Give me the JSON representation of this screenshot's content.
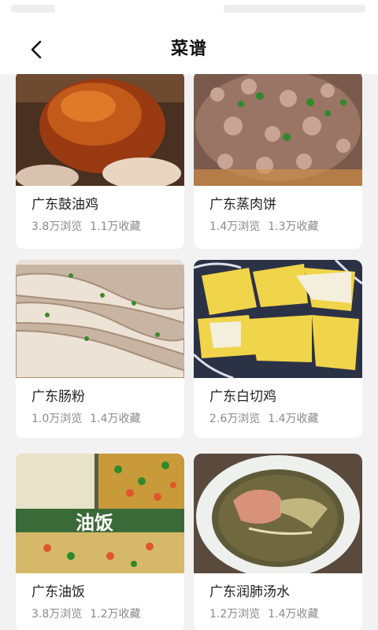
{
  "header": {
    "title": "菜谱"
  },
  "recipes": [
    {
      "name": "广东鼓油鸡",
      "views": "3.8万浏览",
      "favorites": "1.1万收藏"
    },
    {
      "name": "广东蒸肉饼",
      "views": "1.4万浏览",
      "favorites": "1.3万收藏"
    },
    {
      "name": "广东肠粉",
      "views": "1.0万浏览",
      "favorites": "1.4万收藏"
    },
    {
      "name": "广东白切鸡",
      "views": "2.6万浏览",
      "favorites": "1.4万收藏"
    },
    {
      "name": "广东油饭",
      "views": "3.8万浏览",
      "favorites": "1.2万收藏"
    },
    {
      "name": "广东润肺汤水",
      "views": "1.2万浏览",
      "favorites": "1.4万收藏"
    }
  ],
  "image_texts": {
    "youfan_title": "油饭"
  },
  "icons": {
    "back": "chevron-left-icon"
  },
  "colors": {
    "background": "#f2f2f2",
    "card": "#ffffff",
    "title": "#111111",
    "meta": "#8a8a8a"
  }
}
